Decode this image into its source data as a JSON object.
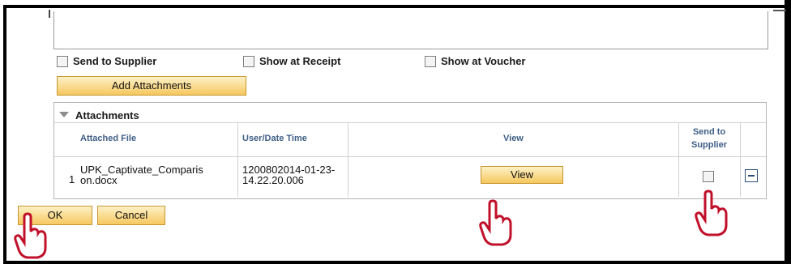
{
  "options": {
    "send_to_supplier": "Send to Supplier",
    "show_at_receipt": "Show at Receipt",
    "show_at_voucher": "Show at Voucher"
  },
  "add_attachments_label": "Add Attachments",
  "attachments": {
    "title": "Attachments",
    "columns": {
      "attached_file": "Attached File",
      "user_date_time": "User/Date Time",
      "view": "View",
      "send_to_supplier_line1": "Send to",
      "send_to_supplier_line2": "Supplier"
    },
    "rows": [
      {
        "index": "1",
        "file_line1": "UPK_Captivate_Comparis",
        "file_line2": "on.docx",
        "datetime_line1": "1200802014-01-23-",
        "datetime_line2": "14.22.20.006",
        "view_label": "View"
      }
    ]
  },
  "footer": {
    "ok_label": "OK",
    "cancel_label": "Cancel"
  },
  "icons": {
    "hand": "pointing-hand-cursor-icon",
    "collapse": "collapse-triangle-icon",
    "delete_row": "minus-icon"
  }
}
